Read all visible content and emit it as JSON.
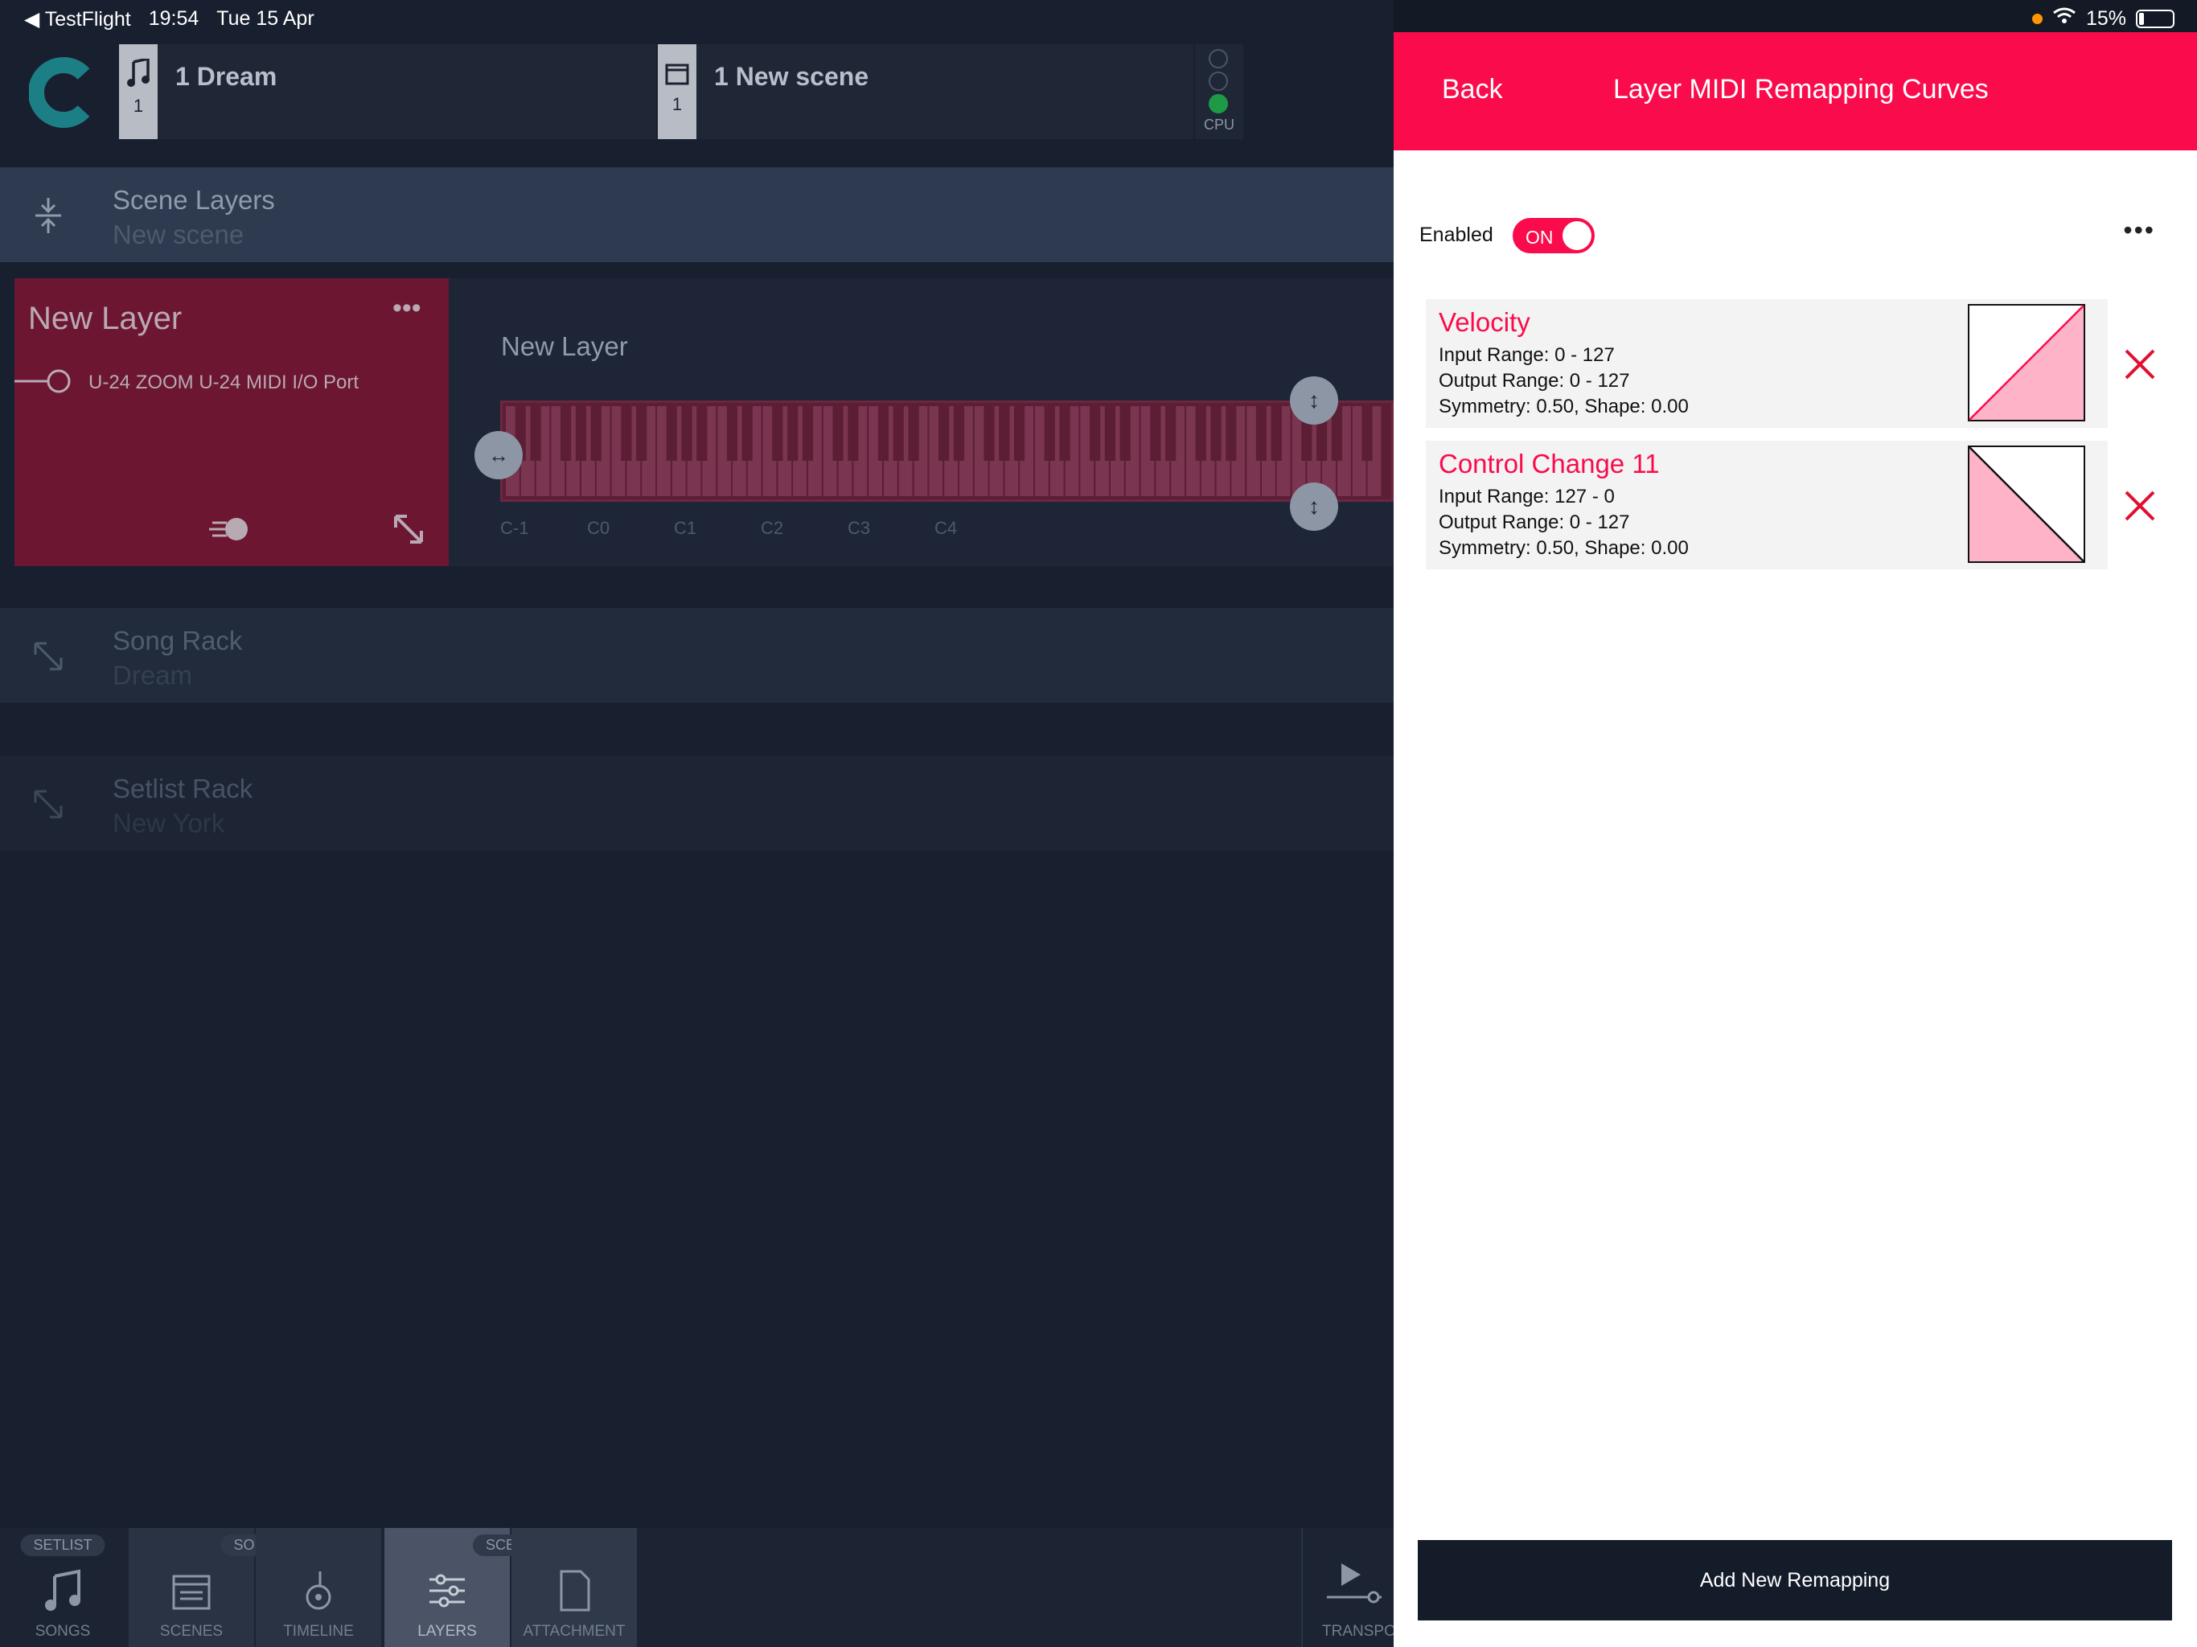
{
  "status_bar": {
    "back_app": "TestFlight",
    "time": "19:54",
    "date": "Tue 15 Apr",
    "battery": "15%"
  },
  "song_bar": {
    "title": "1 Dream",
    "number": "1"
  },
  "scene_bar": {
    "title": "1 New scene",
    "number": "1"
  },
  "cpu_label": "CPU",
  "scene_layers": {
    "title": "Scene Layers",
    "subtitle": "New scene"
  },
  "layer_card": {
    "title": "New Layer",
    "port": "U-24 ZOOM U-24 MIDI I/O Port"
  },
  "keyboard_panel": {
    "title": "New Layer",
    "octaves": [
      "C-1",
      "C0",
      "C1",
      "C2",
      "C3",
      "C4"
    ]
  },
  "song_rack": {
    "title": "Song Rack",
    "subtitle": "Dream"
  },
  "setlist_rack": {
    "title": "Setlist Rack",
    "subtitle": "New York"
  },
  "bottom_tabs": {
    "groups": {
      "setlist": "SETLIST",
      "song": "SONG",
      "scene": "SCENE"
    },
    "songs": "SONGS",
    "scenes": "SCENES",
    "timeline": "TIMELINE",
    "layers": "LAYERS",
    "attachment": "ATTACHMENT",
    "transport": "TRANSPORT"
  },
  "panel": {
    "back": "Back",
    "title": "Layer MIDI Remapping Curves",
    "enabled_label": "Enabled",
    "toggle_label": "ON",
    "remappings": [
      {
        "name": "Velocity",
        "input": "Input Range: 0 - 127",
        "output": "Output Range: 0 - 127",
        "params": "Symmetry: 0.50, Shape: 0.00"
      },
      {
        "name": "Control Change 11",
        "input": "Input Range: 127 - 0",
        "output": "Output Range: 0 - 127",
        "params": "Symmetry: 0.50, Shape: 0.00"
      }
    ],
    "add_button": "Add New Remapping"
  },
  "colors": {
    "accent": "#fa0b4b",
    "curve_fill": "#ffb3c8",
    "layer_card": "#6d1632",
    "background": "#182030"
  }
}
